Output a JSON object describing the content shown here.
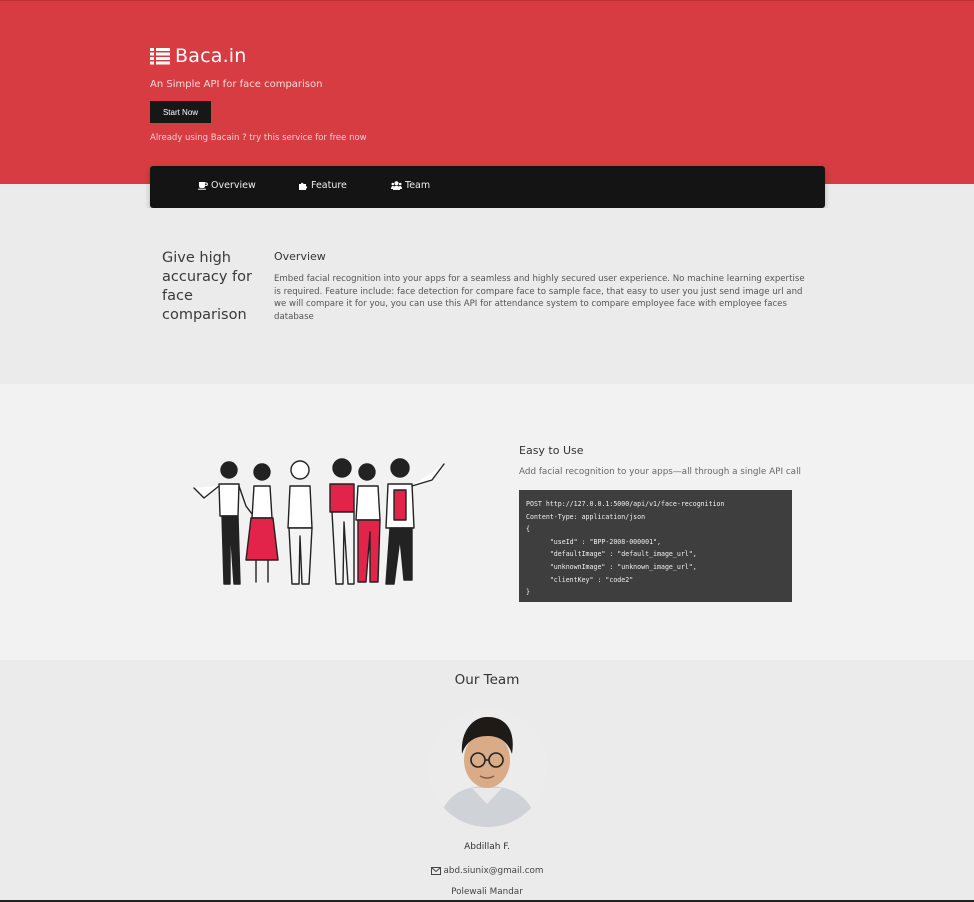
{
  "hero": {
    "brand": "Baca.in",
    "tagline": "An Simple API for face comparison",
    "start_button": "Start Now",
    "already_text": "Already using Bacain ? try this service for free now",
    "background_color": "#d63c41"
  },
  "nav": {
    "items": [
      {
        "label": "Overview",
        "icon": "coffee-icon"
      },
      {
        "label": "Feature",
        "icon": "puzzle-icon"
      },
      {
        "label": "Team",
        "icon": "users-icon"
      }
    ]
  },
  "overview": {
    "heading": "Give high accuracy for face comparison",
    "title": "Overview",
    "text": "Embed facial recognition into your apps for a seamless and highly secured user experience. No machine learning expertise is required. Feature include: face detection for compare face to sample face, that easy to user you just send image url and we will compare it for you, you can use this API for attendance system to compare employee face with employee faces database"
  },
  "feature": {
    "title": "Easy to Use",
    "subtitle": "Add facial recognition to your apps—all through a single API call",
    "code_lines": [
      "POST http://127.0.0.1:5000/api/v1/face-recognition",
      "Content-Type: application/json",
      "{",
      "      \"useId\" : \"BPP-2008-000001\",",
      "      \"defaultImage\" : \"default_image_url\",",
      "      \"unknownImage\" : \"unknown_image_url\",",
      "      \"clientKey\" : \"code2\"",
      "}"
    ]
  },
  "team": {
    "title": "Our Team",
    "member": {
      "name": "Abdillah F.",
      "email": "abd.siunix@gmail.com",
      "city": "Polewali Mandar"
    }
  }
}
